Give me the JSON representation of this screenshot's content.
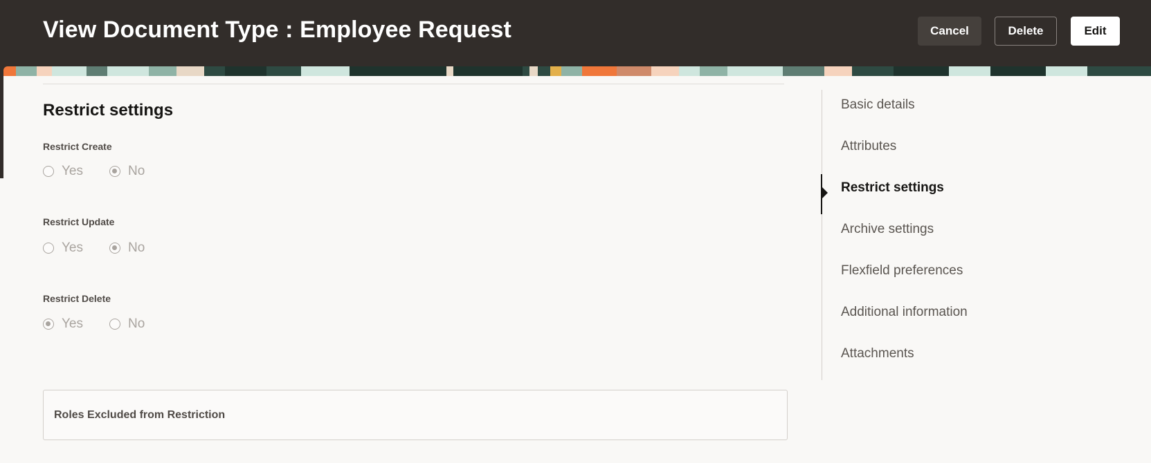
{
  "header": {
    "title": "View Document Type : Employee Request",
    "buttons": {
      "cancel": "Cancel",
      "delete": "Delete",
      "edit": "Edit"
    }
  },
  "section": {
    "title": "Restrict settings",
    "fields": [
      {
        "label": "Restrict Create",
        "options": [
          "Yes",
          "No"
        ],
        "selected": "No"
      },
      {
        "label": "Restrict Update",
        "options": [
          "Yes",
          "No"
        ],
        "selected": "No"
      },
      {
        "label": "Restrict Delete",
        "options": [
          "Yes",
          "No"
        ],
        "selected": "Yes"
      }
    ],
    "roles_label": "Roles Excluded from Restriction"
  },
  "nav": {
    "items": [
      {
        "label": "Basic details",
        "active": false
      },
      {
        "label": "Attributes",
        "active": false
      },
      {
        "label": "Restrict settings",
        "active": true
      },
      {
        "label": "Archive settings",
        "active": false
      },
      {
        "label": "Flexfield preferences",
        "active": false
      },
      {
        "label": "Additional information",
        "active": false
      },
      {
        "label": "Attachments",
        "active": false
      }
    ]
  },
  "colors": {
    "header_bg": "#322d2a",
    "page_bg": "#f9f8f6",
    "banner_dark": "#2e4a42",
    "banner_orange": "#f0773a",
    "banner_mint": "#cfe6de",
    "banner_peach": "#f6d3bd"
  }
}
